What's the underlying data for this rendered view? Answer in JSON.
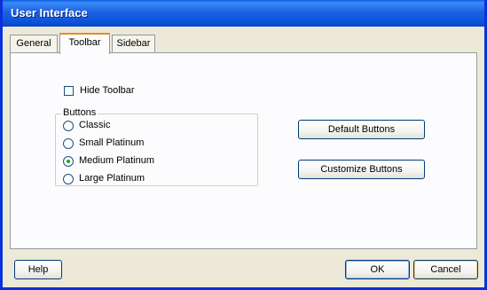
{
  "window": {
    "title": "User Interface"
  },
  "tabs": [
    {
      "label": "General",
      "active": false
    },
    {
      "label": "Toolbar",
      "active": true
    },
    {
      "label": "Sidebar",
      "active": false
    }
  ],
  "toolbar_page": {
    "hide_toolbar": {
      "label": "Hide Toolbar",
      "checked": false
    },
    "buttons_group": {
      "title": "Buttons",
      "options": [
        {
          "label": "Classic",
          "selected": false
        },
        {
          "label": "Small Platinum",
          "selected": false
        },
        {
          "label": "Medium Platinum",
          "selected": true
        },
        {
          "label": "Large Platinum",
          "selected": false
        }
      ]
    },
    "default_buttons_label": "Default Buttons",
    "customize_buttons_label": "Customize Buttons"
  },
  "footer": {
    "help_label": "Help",
    "ok_label": "OK",
    "cancel_label": "Cancel"
  },
  "colors": {
    "titlebar": "#0b52d8",
    "window_bg": "#ece9d8",
    "panel_bg": "#fcfcfe",
    "active_tab_accent": "#e68b2c",
    "radio_dot": "#21a121"
  }
}
